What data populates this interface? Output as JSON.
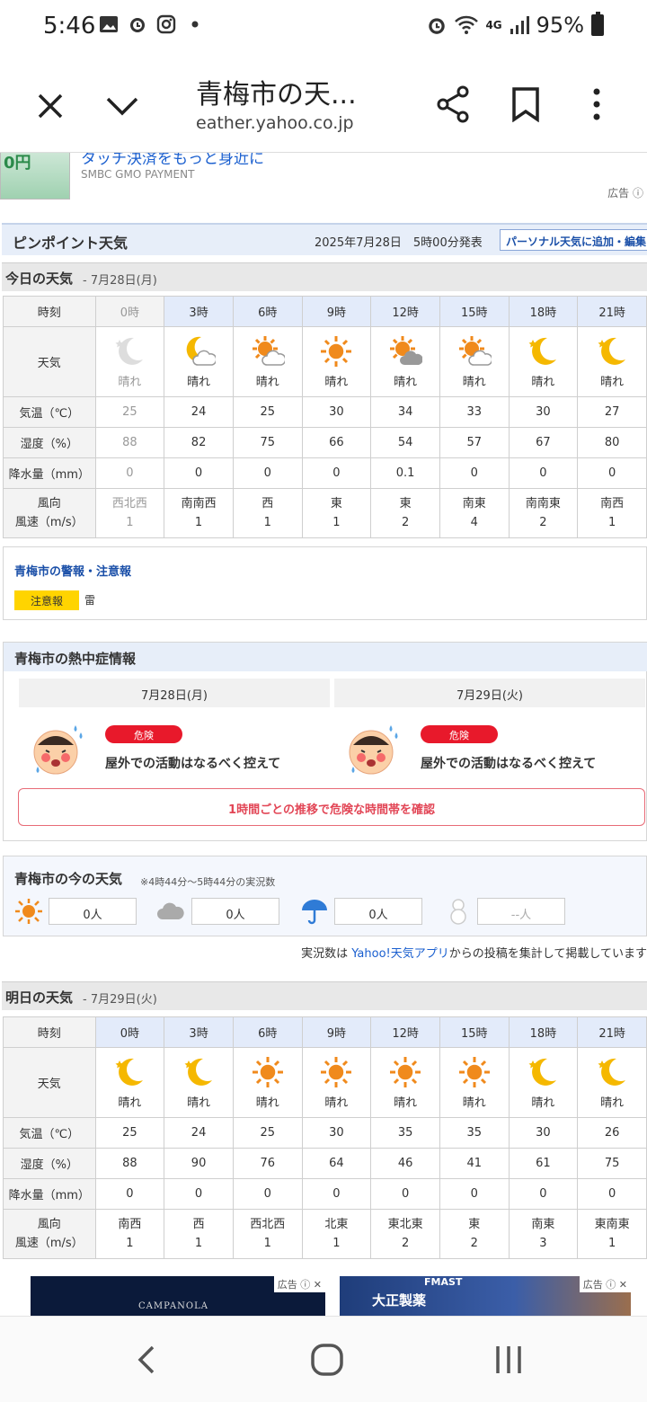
{
  "status_bar": {
    "time": "5:46",
    "battery": "95%",
    "network": "4G"
  },
  "browser": {
    "title": "青梅市の天...",
    "url": "eather.yahoo.co.jp"
  },
  "ad_top": {
    "thumb_text": "0円",
    "headline": "タッチ決済をもっと身近に",
    "sponsor": "SMBC GMO PAYMENT",
    "label": "広告"
  },
  "pinpoint": {
    "title": "ピンポイント天気",
    "issued": "2025年7月28日　5時00分発表",
    "add_button": "パーソナル天気に追加・編集"
  },
  "labels": {
    "time": "時刻",
    "weather": "天気",
    "temp": "気温（℃）",
    "humidity": "湿度（%）",
    "precip": "降水量（mm）",
    "wind_dir": "風向",
    "wind_speed": "風速（m/s）"
  },
  "today": {
    "title": "今日の天気",
    "date": "- 7月28日(月)",
    "hours": [
      "0時",
      "3時",
      "6時",
      "9時",
      "12時",
      "15時",
      "18時",
      "21時"
    ],
    "icons": [
      "moon-icon",
      "moon-cloud-icon",
      "sun-cloud-icon",
      "sun-icon",
      "sun-cloud-icon",
      "sun-cloud-icon",
      "moon-icon",
      "moon-icon"
    ],
    "conditions": [
      "晴れ",
      "晴れ",
      "晴れ",
      "晴れ",
      "晴れ",
      "晴れ",
      "晴れ",
      "晴れ"
    ],
    "temp": [
      "25",
      "24",
      "25",
      "30",
      "34",
      "33",
      "30",
      "27"
    ],
    "humidity": [
      "88",
      "82",
      "75",
      "66",
      "54",
      "57",
      "67",
      "80"
    ],
    "precip": [
      "0",
      "0",
      "0",
      "0",
      "0.1",
      "0",
      "0",
      "0"
    ],
    "wind_dir": [
      "西北西",
      "南南西",
      "西",
      "東",
      "東",
      "南東",
      "南南東",
      "南西"
    ],
    "wind_speed": [
      "1",
      "1",
      "1",
      "1",
      "2",
      "4",
      "2",
      "1"
    ]
  },
  "warning": {
    "title": "青梅市の警報・注意報",
    "badge": "注意報",
    "text": "雷"
  },
  "heatstroke": {
    "title": "青梅市の熱中症情報",
    "days": [
      {
        "date": "7月28日(月)",
        "level": "危険",
        "message": "屋外での活動はなるべく控えて"
      },
      {
        "date": "7月29日(火)",
        "level": "危険",
        "message": "屋外での活動はなるべく控えて"
      }
    ],
    "link": "1時間ごとの推移で危険な時間帯を確認"
  },
  "now": {
    "title": "青梅市の今の天気",
    "subtitle": "※4時44分〜5時44分の実況数",
    "counts": [
      "0人",
      "0人",
      "0人",
      "--人"
    ],
    "note_prefix": "実況数は ",
    "note_link": "Yahoo!天気アプリ",
    "note_suffix": "からの投稿を集計して掲載しています"
  },
  "tomorrow": {
    "title": "明日の天気",
    "date": "- 7月29日(火)",
    "hours": [
      "0時",
      "3時",
      "6時",
      "9時",
      "12時",
      "15時",
      "18時",
      "21時"
    ],
    "icons": [
      "moon-icon",
      "moon-icon",
      "sun-icon",
      "sun-icon",
      "sun-icon",
      "sun-icon",
      "moon-icon",
      "moon-icon"
    ],
    "conditions": [
      "晴れ",
      "晴れ",
      "晴れ",
      "晴れ",
      "晴れ",
      "晴れ",
      "晴れ",
      "晴れ"
    ],
    "temp": [
      "25",
      "24",
      "25",
      "30",
      "35",
      "35",
      "30",
      "26"
    ],
    "humidity": [
      "88",
      "90",
      "76",
      "64",
      "46",
      "41",
      "61",
      "75"
    ],
    "precip": [
      "0",
      "0",
      "0",
      "0",
      "0",
      "0",
      "0",
      "0"
    ],
    "wind_dir": [
      "南西",
      "西",
      "西北西",
      "北東",
      "東北東",
      "東",
      "南東",
      "東南東"
    ],
    "wind_speed": [
      "1",
      "1",
      "1",
      "1",
      "2",
      "2",
      "3",
      "1"
    ]
  },
  "bottom_ads": {
    "label": "広告",
    "ad1_brand": "CAMPANOLA",
    "ad2_brand": "大正製薬",
    "ad2_brand2": "FMAST"
  },
  "colors": {
    "accent": "#1a5fcf",
    "sun": "#f08a1c",
    "moon": "#f5b800",
    "danger": "#e8192b",
    "caution": "#ffd400"
  }
}
